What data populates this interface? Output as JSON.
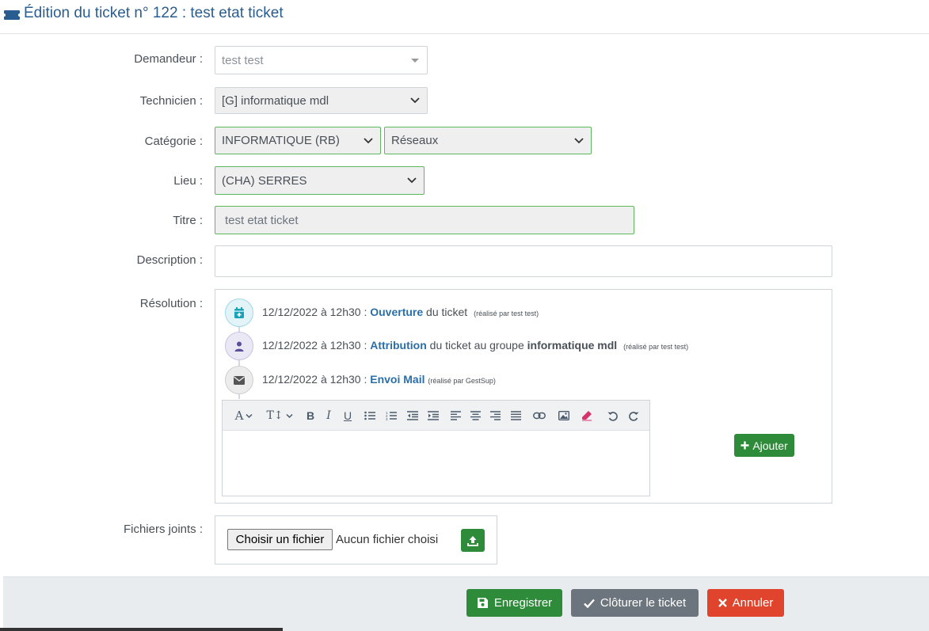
{
  "header": {
    "title": "Édition du ticket n° 122 : test etat ticket"
  },
  "form": {
    "demandeur": {
      "label": "Demandeur :",
      "value": "test test"
    },
    "technicien": {
      "label": "Technicien :",
      "value": "[G] informatique mdl"
    },
    "categorie": {
      "label": "Catégorie :",
      "value": "INFORMATIQUE (RB)",
      "subvalue": "Réseaux"
    },
    "lieu": {
      "label": "Lieu :",
      "value": "(CHA) SERRES"
    },
    "titre": {
      "label": "Titre :",
      "value": "test etat ticket"
    },
    "description": {
      "label": "Description :",
      "value": ""
    },
    "resolution": {
      "label": "Résolution :"
    },
    "fichiers": {
      "label": "Fichiers joints :",
      "choose": "Choisir un fichier",
      "status": "Aucun fichier choisi"
    }
  },
  "timeline": [
    {
      "date": "12/12/2022 à 12h30 :",
      "action": "Ouverture",
      "rest": "du ticket",
      "group": "",
      "by": "(réalisé par test test)",
      "icon": "calendar-plus-icon",
      "color": "#17a2b8",
      "bg": "#e3f4f8"
    },
    {
      "date": "12/12/2022 à 12h30 :",
      "action": "Attribution",
      "rest": "du ticket au groupe",
      "group": "informatique mdl",
      "by": "(réalisé par test test)",
      "icon": "user-icon",
      "color": "#5a4d9c",
      "bg": "#eae8f4"
    },
    {
      "date": "12/12/2022 à 12h30 :",
      "action": "Envoi Mail",
      "rest": "",
      "group": "",
      "by": "(réalisé par GestSup)",
      "icon": "envelope-icon",
      "color": "#555555",
      "bg": "#ececec"
    }
  ],
  "editor": {
    "tools": [
      "font-color",
      "font-size",
      "bold",
      "italic",
      "underline",
      "bullet-list",
      "numbered-list",
      "outdent",
      "indent",
      "align-left",
      "align-center",
      "align-right",
      "justify",
      "link",
      "image",
      "eraser",
      "undo",
      "redo"
    ]
  },
  "buttons": {
    "ajouter": "Ajouter",
    "enregistrer": "Enregistrer",
    "cloturer": "Clôturer le ticket",
    "annuler": "Annuler"
  }
}
